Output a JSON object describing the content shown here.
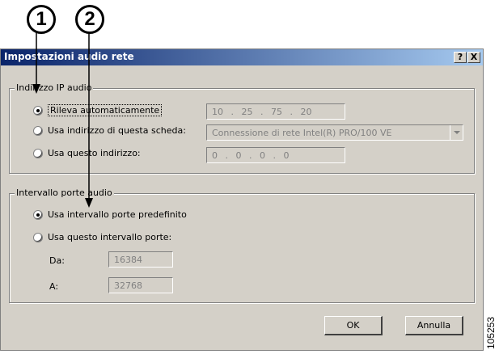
{
  "callouts": [
    "1",
    "2"
  ],
  "dialog": {
    "title": "Impostazioni audio rete",
    "help_label": "?",
    "close_label": "X"
  },
  "ip_group": {
    "legend": "Indirizzo IP audio",
    "options": [
      {
        "label": "Rileva automaticamente",
        "checked": true,
        "focused": true
      },
      {
        "label": "Usa indirizzo di questa scheda:",
        "checked": false
      },
      {
        "label": "Usa questo indirizzo:",
        "checked": false
      }
    ],
    "auto_ip_value": "10 . 25 . 75 . 20",
    "adapter_value": "Connessione di rete Intel(R) PRO/100 VE",
    "manual_ip_value": "0 . 0 . 0 . 0"
  },
  "port_group": {
    "legend": "Intervallo porte audio",
    "options": [
      {
        "label": "Usa intervallo porte predefinito",
        "checked": true
      },
      {
        "label": "Usa questo intervallo porte:",
        "checked": false
      }
    ],
    "from_label": "Da:",
    "from_value": "16384",
    "to_label": "A:",
    "to_value": "32768"
  },
  "buttons": {
    "ok_label": "OK",
    "cancel_label": "Annulla"
  },
  "figure_id": "105253"
}
